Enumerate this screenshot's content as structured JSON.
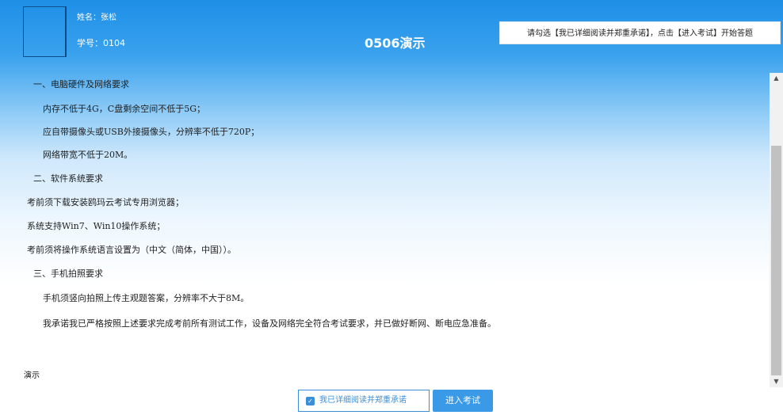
{
  "header": {
    "name_label": "姓名：张松",
    "id_label": "学号：0104",
    "exam_title": "0506演示",
    "notice": "请勾选【我已详细阅读并郑重承诺】，点击【进入考试】开始答题"
  },
  "content": {
    "lines": [
      "一、电脑硬件及网络要求",
      "内存不低于4G，C盘剩余空间不低于5G；",
      "应自带摄像头或USB外接摄像头，分辨率不低于720P；",
      "网络带宽不低于20M。",
      "二、软件系统要求",
      "考前须下载安装鸥玛云考试专用浏览器；",
      "系统支持Win7、Win10操作系统；",
      "考前须将操作系统语言设置为（中文（简体，中国））。",
      "三、手机拍照要求",
      "手机须竖向拍照上传主观题答案，分辨率不大于8M。",
      "我承诺我已严格按照上述要求完成考前所有测试工作，设备及网络完全符合考试要求，并已做好断网、断电应急准备。"
    ],
    "footer_label": "演示"
  },
  "actions": {
    "agree_label": "我已详细阅读并郑重承诺",
    "enter_label": "进入考试"
  },
  "colors": {
    "header_blue": "#1e8fe6",
    "accent": "#3a8fd8"
  }
}
